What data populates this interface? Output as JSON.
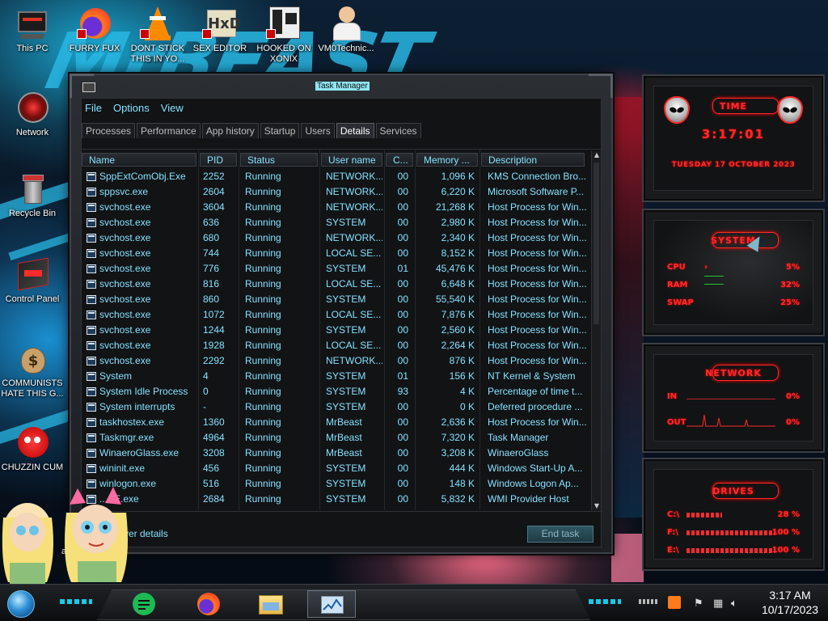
{
  "desktop": {
    "icons": [
      {
        "label": "This PC"
      },
      {
        "label": "FURRY FUX"
      },
      {
        "label": "DONT STICK THIS IN YO..."
      },
      {
        "label": "SEX EDITOR"
      },
      {
        "label": "HOOKED ON XONIX"
      },
      {
        "label": "VM0Technic..."
      },
      {
        "label": "Network"
      },
      {
        "label": "Recycle Bin"
      },
      {
        "label": "Control Panel"
      },
      {
        "label": "COMMUNISTS HATE THIS G..."
      },
      {
        "label": "CHUZZIN CUM"
      },
      {
        "label": "ad"
      }
    ]
  },
  "task_manager": {
    "title": "Task Manager",
    "menu": [
      "File",
      "Options",
      "View"
    ],
    "tabs": [
      "Processes",
      "Performance",
      "App history",
      "Startup",
      "Users",
      "Details",
      "Services"
    ],
    "active_tab": "Details",
    "columns": [
      "Name",
      "PID",
      "Status",
      "User name",
      "C...",
      "Memory ...",
      "Description"
    ],
    "rows": [
      {
        "name": "SppExtComObj.Exe",
        "pid": "2252",
        "status": "Running",
        "user": "NETWORK...",
        "cpu": "00",
        "memory": "1,096 K",
        "desc": "KMS Connection Bro..."
      },
      {
        "name": "sppsvc.exe",
        "pid": "2604",
        "status": "Running",
        "user": "NETWORK...",
        "cpu": "00",
        "memory": "6,220 K",
        "desc": "Microsoft Software P..."
      },
      {
        "name": "svchost.exe",
        "pid": "3604",
        "status": "Running",
        "user": "NETWORK...",
        "cpu": "00",
        "memory": "21,268 K",
        "desc": "Host Process for Win..."
      },
      {
        "name": "svchost.exe",
        "pid": "636",
        "status": "Running",
        "user": "SYSTEM",
        "cpu": "00",
        "memory": "2,980 K",
        "desc": "Host Process for Win..."
      },
      {
        "name": "svchost.exe",
        "pid": "680",
        "status": "Running",
        "user": "NETWORK...",
        "cpu": "00",
        "memory": "2,340 K",
        "desc": "Host Process for Win..."
      },
      {
        "name": "svchost.exe",
        "pid": "744",
        "status": "Running",
        "user": "LOCAL SE...",
        "cpu": "00",
        "memory": "8,152 K",
        "desc": "Host Process for Win..."
      },
      {
        "name": "svchost.exe",
        "pid": "776",
        "status": "Running",
        "user": "SYSTEM",
        "cpu": "01",
        "memory": "45,476 K",
        "desc": "Host Process for Win..."
      },
      {
        "name": "svchost.exe",
        "pid": "816",
        "status": "Running",
        "user": "LOCAL SE...",
        "cpu": "00",
        "memory": "6,648 K",
        "desc": "Host Process for Win..."
      },
      {
        "name": "svchost.exe",
        "pid": "860",
        "status": "Running",
        "user": "SYSTEM",
        "cpu": "00",
        "memory": "55,540 K",
        "desc": "Host Process for Win..."
      },
      {
        "name": "svchost.exe",
        "pid": "1072",
        "status": "Running",
        "user": "LOCAL SE...",
        "cpu": "00",
        "memory": "7,876 K",
        "desc": "Host Process for Win..."
      },
      {
        "name": "svchost.exe",
        "pid": "1244",
        "status": "Running",
        "user": "SYSTEM",
        "cpu": "00",
        "memory": "2,560 K",
        "desc": "Host Process for Win..."
      },
      {
        "name": "svchost.exe",
        "pid": "1928",
        "status": "Running",
        "user": "LOCAL SE...",
        "cpu": "00",
        "memory": "2,264 K",
        "desc": "Host Process for Win..."
      },
      {
        "name": "svchost.exe",
        "pid": "2292",
        "status": "Running",
        "user": "NETWORK...",
        "cpu": "00",
        "memory": "876 K",
        "desc": "Host Process for Win..."
      },
      {
        "name": "System",
        "pid": "4",
        "status": "Running",
        "user": "SYSTEM",
        "cpu": "01",
        "memory": "156 K",
        "desc": "NT Kernel & System"
      },
      {
        "name": "System Idle Process",
        "pid": "0",
        "status": "Running",
        "user": "SYSTEM",
        "cpu": "93",
        "memory": "4 K",
        "desc": "Percentage of time t..."
      },
      {
        "name": "System interrupts",
        "pid": "-",
        "status": "Running",
        "user": "SYSTEM",
        "cpu": "00",
        "memory": "0 K",
        "desc": "Deferred procedure ..."
      },
      {
        "name": "taskhostex.exe",
        "pid": "1360",
        "status": "Running",
        "user": "MrBeast",
        "cpu": "00",
        "memory": "2,636 K",
        "desc": "Host Process for Win..."
      },
      {
        "name": "Taskmgr.exe",
        "pid": "4964",
        "status": "Running",
        "user": "MrBeast",
        "cpu": "00",
        "memory": "7,320 K",
        "desc": "Task Manager"
      },
      {
        "name": "WinaeroGlass.exe",
        "pid": "3208",
        "status": "Running",
        "user": "MrBeast",
        "cpu": "00",
        "memory": "3,208 K",
        "desc": "WinaeroGlass"
      },
      {
        "name": "wininit.exe",
        "pid": "456",
        "status": "Running",
        "user": "SYSTEM",
        "cpu": "00",
        "memory": "444 K",
        "desc": "Windows Start-Up A..."
      },
      {
        "name": "winlogon.exe",
        "pid": "516",
        "status": "Running",
        "user": "SYSTEM",
        "cpu": "00",
        "memory": "148 K",
        "desc": "Windows Logon Ap..."
      },
      {
        "name": "...SE.exe",
        "pid": "2684",
        "status": "Running",
        "user": "SYSTEM",
        "cpu": "00",
        "memory": "5,832 K",
        "desc": "WMI Provider Host"
      }
    ],
    "fewer_details": "...ver details",
    "end_task": "End task"
  },
  "gadgets": {
    "time": {
      "title": "TIME",
      "time": "3:17:01",
      "date": "TUESDAY 17 OCTOBER 2023"
    },
    "system": {
      "title": "SYSTEM",
      "cpu_label": "CPU",
      "cpu_value": "5%",
      "ram_label": "RAM",
      "ram_value": "32%",
      "swap_label": "SWAP",
      "swap_value": "25%"
    },
    "network": {
      "title": "NETWORK",
      "in_label": "IN",
      "in_value": "0%",
      "out_label": "OUT",
      "out_value": "0%"
    },
    "drives": {
      "title": "DRIVES",
      "items": [
        {
          "label": "C:\\",
          "value": "28 %"
        },
        {
          "label": "F:\\",
          "value": "100 %"
        },
        {
          "label": "E:\\",
          "value": "100 %"
        }
      ]
    }
  },
  "taskbar": {
    "time": "3:17 AM",
    "date": "10/17/2023"
  },
  "colors": {
    "accent_cyan": "#86e2ff",
    "gadget_red": "#ff2a2a",
    "taskbar_cyan": "#19c9e8"
  }
}
